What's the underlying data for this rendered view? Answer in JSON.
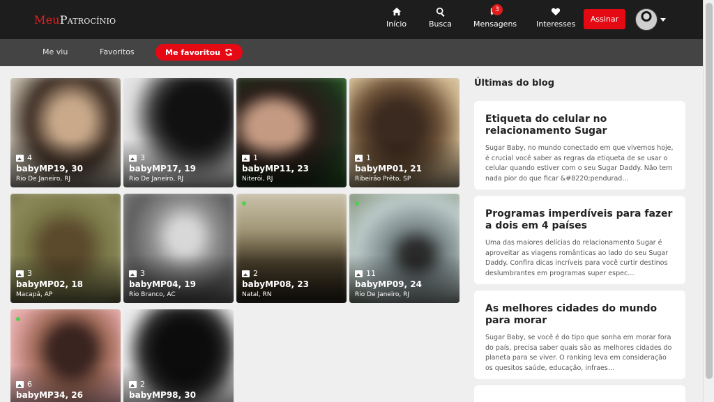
{
  "brand": {
    "part1": "Meu",
    "part2": "Patrocínio"
  },
  "nav": {
    "inicio": "Início",
    "busca": "Busca",
    "mensagens": "Mensagens",
    "mensagens_badge": "3",
    "interesses": "Interesses",
    "assinar": "Assinar"
  },
  "tabs": {
    "me_viu": "Me viu",
    "favoritos": "Favoritos",
    "me_favoritou": "Me favoritou"
  },
  "profiles": [
    {
      "photos": "4",
      "name": "babyMP19, 30",
      "city": "Rio De Janeiro, RJ",
      "online": false
    },
    {
      "photos": "3",
      "name": "babyMP17, 19",
      "city": "Rio De Janeiro, RJ",
      "online": false
    },
    {
      "photos": "1",
      "name": "babyMP11, 23",
      "city": "Niterói, RJ",
      "online": false
    },
    {
      "photos": "1",
      "name": "babyMP01, 21",
      "city": "Ribeirão Prêto, SP",
      "online": false
    },
    {
      "photos": "3",
      "name": "babyMP02, 18",
      "city": "Macapá, AP",
      "online": false
    },
    {
      "photos": "3",
      "name": "babyMP04, 19",
      "city": "Rio Branco, AC",
      "online": false
    },
    {
      "photos": "2",
      "name": "babyMP08, 23",
      "city": "Natal, RN",
      "online": true
    },
    {
      "photos": "11",
      "name": "babyMP09, 24",
      "city": "Rio De Janeiro, RJ",
      "online": true
    },
    {
      "photos": "6",
      "name": "babyMP34, 26",
      "city": "",
      "online": true
    },
    {
      "photos": "2",
      "name": "babyMP98, 30",
      "city": "",
      "online": false
    }
  ],
  "blog": {
    "heading": "Últimas do blog",
    "posts": [
      {
        "title": "Etiqueta do celular no relacionamento Sugar",
        "excerpt": "Sugar Baby, no mundo conectado em que vivemos hoje, é crucial você saber as regras da etiqueta de se usar o celular quando estiver com o seu Sugar Daddy. Não tem nada pior do que ficar &#8220;pendurad…"
      },
      {
        "title": "Programas imperdíveis para fazer a dois em 4 países",
        "excerpt": "Uma das maiores delícias do relacionamento Sugar é aproveitar as viagens românticas ao lado do seu Sugar Daddy. Confira dicas incríveis para você curtir destinos deslumbrantes em programas super espec…"
      },
      {
        "title": "As melhores cidades do mundo para morar",
        "excerpt": "Sugar Baby, se você é do tipo que sonha em morar fora do país, precisa saber quais são as melhores cidades do planeta para se viver. O ranking leva em consideração os quesitos saúde, educação, infraes…"
      }
    ]
  },
  "colors": {
    "accent": "#e50914",
    "topbar": "#1d1d1d",
    "subbar": "#444444",
    "online": "#4cd14c"
  }
}
